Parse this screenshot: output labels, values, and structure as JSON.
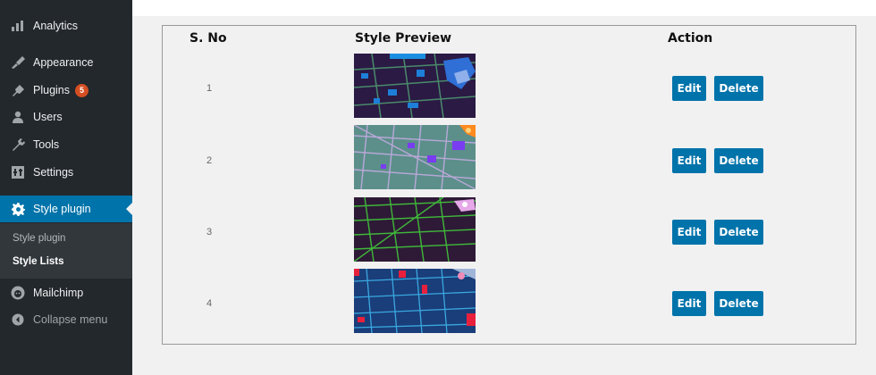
{
  "sidebar": {
    "items": [
      {
        "label": "Analytics",
        "icon": "bar-chart-icon"
      },
      {
        "label": "Appearance",
        "icon": "paintbrush-icon"
      },
      {
        "label": "Plugins",
        "icon": "plug-icon",
        "badge": "5"
      },
      {
        "label": "Users",
        "icon": "user-icon"
      },
      {
        "label": "Tools",
        "icon": "wrench-icon"
      },
      {
        "label": "Settings",
        "icon": "settings-icon"
      },
      {
        "label": "Style plugin",
        "icon": "gear-icon",
        "active": true
      },
      {
        "label": "Mailchimp",
        "icon": "mailchimp-icon"
      },
      {
        "label": "Collapse menu",
        "icon": "collapse-icon"
      }
    ],
    "submenu": [
      "Style plugin",
      "Style Lists"
    ]
  },
  "table": {
    "headers": {
      "sno": "S. No",
      "preview": "Style Preview",
      "action": "Action"
    },
    "rows": [
      {
        "sno": "1",
        "edit": "Edit",
        "delete": "Delete"
      },
      {
        "sno": "2",
        "edit": "Edit",
        "delete": "Delete"
      },
      {
        "sno": "3",
        "edit": "Edit",
        "delete": "Delete"
      },
      {
        "sno": "4",
        "edit": "Edit",
        "delete": "Delete"
      }
    ]
  },
  "colors": {
    "sidebar_bg": "#23282d",
    "active_bg": "#0073aa",
    "button_bg": "#0073aa",
    "badge_bg": "#d54e21"
  }
}
